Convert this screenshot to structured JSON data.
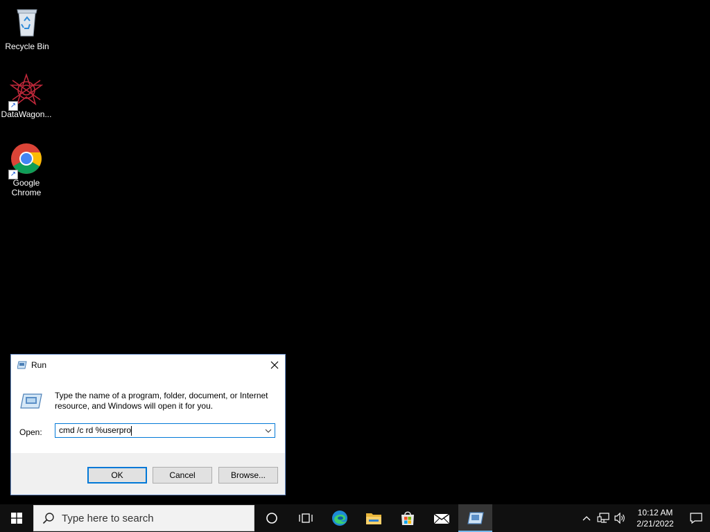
{
  "desktop": {
    "icons": [
      {
        "label": "Recycle Bin"
      },
      {
        "label": "DataWagon..."
      },
      {
        "label": "Google Chrome"
      }
    ]
  },
  "run_dialog": {
    "title": "Run",
    "description": "Type the name of a program, folder, document, or Internet resource, and Windows will open it for you.",
    "open_label": "Open:",
    "input_value": "cmd /c rd %userpro",
    "buttons": {
      "ok": "OK",
      "cancel": "Cancel",
      "browse": "Browse..."
    }
  },
  "taskbar": {
    "search_placeholder": "Type here to search",
    "time": "10:12 AM",
    "date": "2/21/2022"
  },
  "colors": {
    "accent": "#0078d7",
    "desktop_bg": "#000000",
    "taskbar_bg": "#101010"
  }
}
